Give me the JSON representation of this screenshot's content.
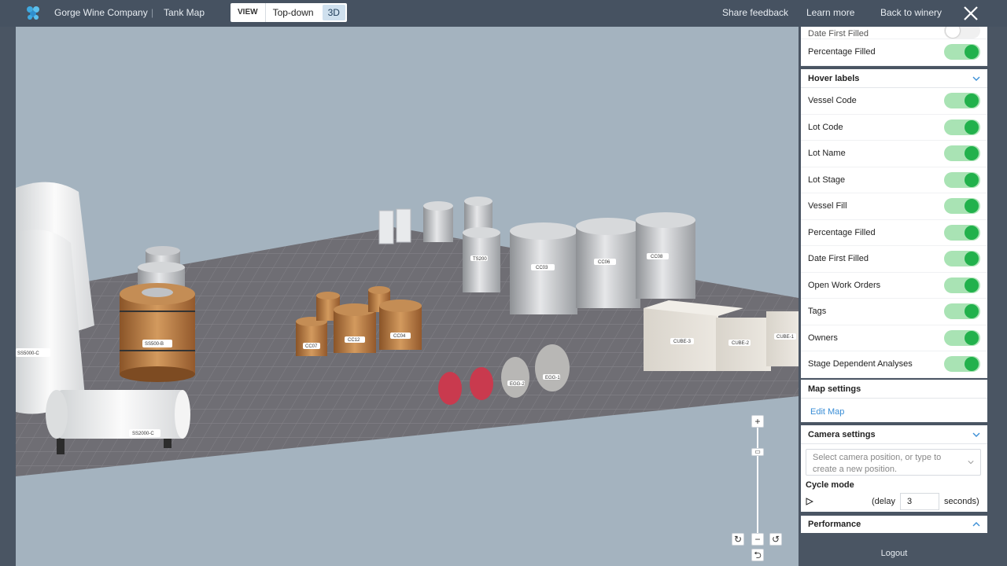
{
  "header": {
    "company": "Gorge Wine Company",
    "separator": "|",
    "section": "Tank Map",
    "view_label": "VIEW",
    "view_options": [
      "Top-down",
      "3D"
    ],
    "active_view": "3D",
    "links": [
      "Share feedback",
      "Learn more",
      "Back to winery"
    ],
    "accent_color": "#22b14c"
  },
  "scene_labels": {
    "ss5000c": "SS5000-C",
    "ss500b": "SS500-B",
    "ss2000c": "SS2000-C",
    "cc03": "CC03",
    "cc06": "CC06",
    "cc08": "CC08",
    "ts200": "TS200",
    "cc07": "CC07",
    "cc12": "CC12",
    "cc04": "CC04",
    "cube3": "CUBE-3",
    "cube2": "CUBE-2",
    "cube1": "CUBE-1",
    "egg2": "EGG-2",
    "egg1": "EGG-1"
  },
  "panel": {
    "top_rows": [
      {
        "label": "Date First Filled",
        "on": false
      },
      {
        "label": "Percentage Filled",
        "on": true
      }
    ],
    "hover_labels": {
      "title": "Hover labels",
      "rows": [
        {
          "label": "Vessel Code",
          "on": true
        },
        {
          "label": "Lot Code",
          "on": true
        },
        {
          "label": "Lot Name",
          "on": true
        },
        {
          "label": "Lot Stage",
          "on": true
        },
        {
          "label": "Vessel Fill",
          "on": true
        },
        {
          "label": "Percentage Filled",
          "on": true
        },
        {
          "label": "Date First Filled",
          "on": true
        },
        {
          "label": "Open Work Orders",
          "on": true
        },
        {
          "label": "Tags",
          "on": true
        },
        {
          "label": "Owners",
          "on": true
        },
        {
          "label": "Stage Dependent Analyses",
          "on": true
        }
      ]
    },
    "map_settings": {
      "title": "Map settings",
      "edit_link": "Edit Map"
    },
    "camera_settings": {
      "title": "Camera settings",
      "placeholder": "Select camera position, or type to create a new position.",
      "cycle_title": "Cycle mode",
      "delay_label": "(delay",
      "delay_value": "3",
      "seconds_label": "seconds)"
    },
    "performance": {
      "title": "Performance"
    },
    "logout": "Logout"
  },
  "zoom": {
    "plus": "+",
    "minus": "−"
  }
}
